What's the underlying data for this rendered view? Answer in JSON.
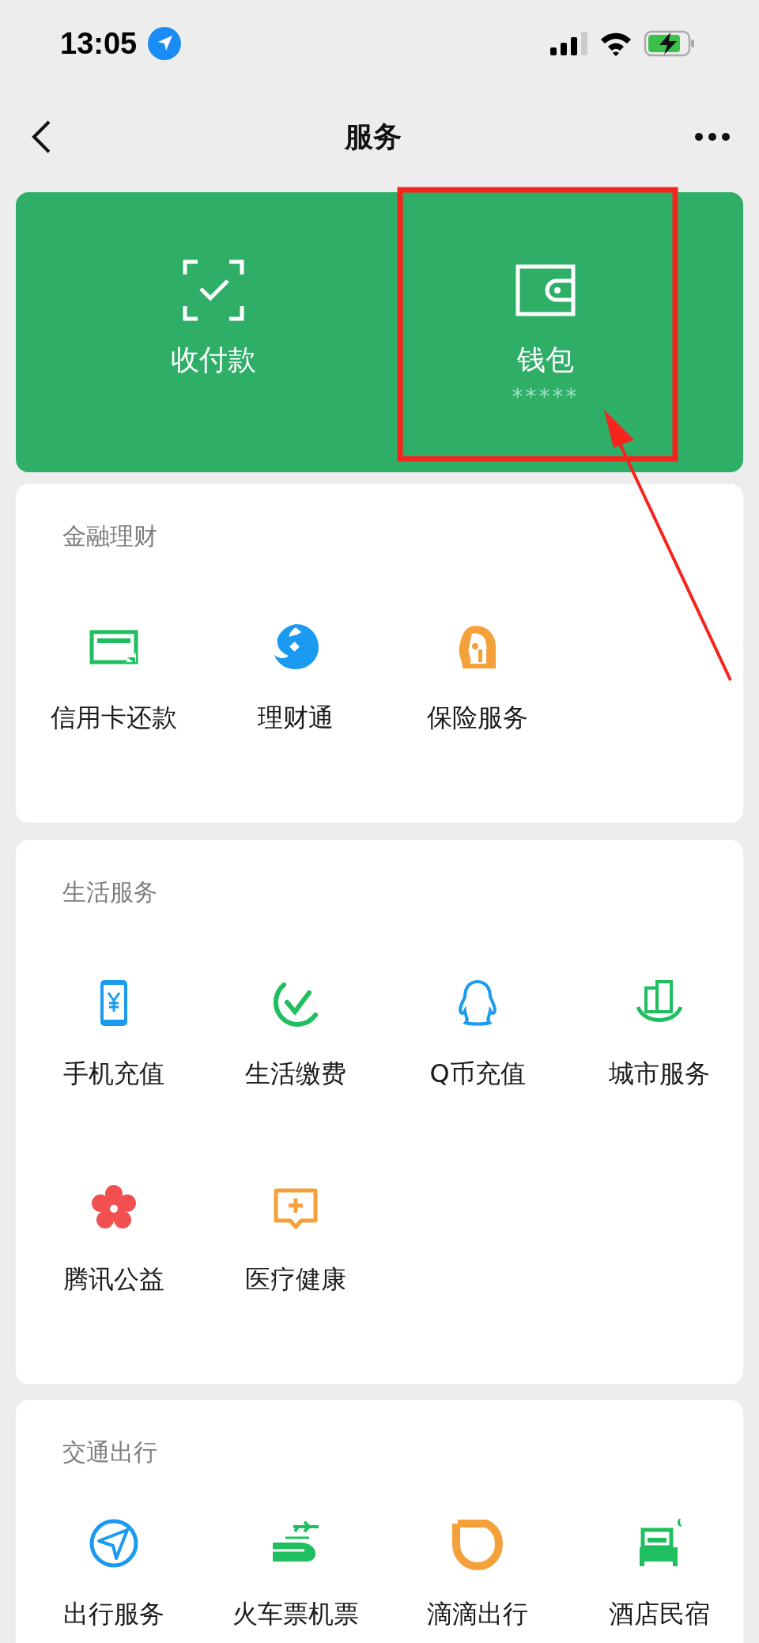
{
  "status_bar": {
    "time": "13:05"
  },
  "nav": {
    "title": "服务"
  },
  "top_panel": {
    "items": [
      {
        "label": "收付款"
      },
      {
        "label": "钱包",
        "detail": "*****"
      }
    ]
  },
  "sections": [
    {
      "title": "金融理财",
      "items": [
        {
          "label": "信用卡还款"
        },
        {
          "label": "理财通"
        },
        {
          "label": "保险服务"
        }
      ]
    },
    {
      "title": "生活服务",
      "items": [
        {
          "label": "手机充值"
        },
        {
          "label": "生活缴费"
        },
        {
          "label": "Q币充值"
        },
        {
          "label": "城市服务"
        },
        {
          "label": "腾讯公益"
        },
        {
          "label": "医疗健康"
        }
      ]
    },
    {
      "title": "交通出行",
      "items": [
        {
          "label": "出行服务"
        },
        {
          "label": "火车票机票"
        },
        {
          "label": "滴滴出行"
        },
        {
          "label": "酒店民宿"
        }
      ]
    }
  ]
}
